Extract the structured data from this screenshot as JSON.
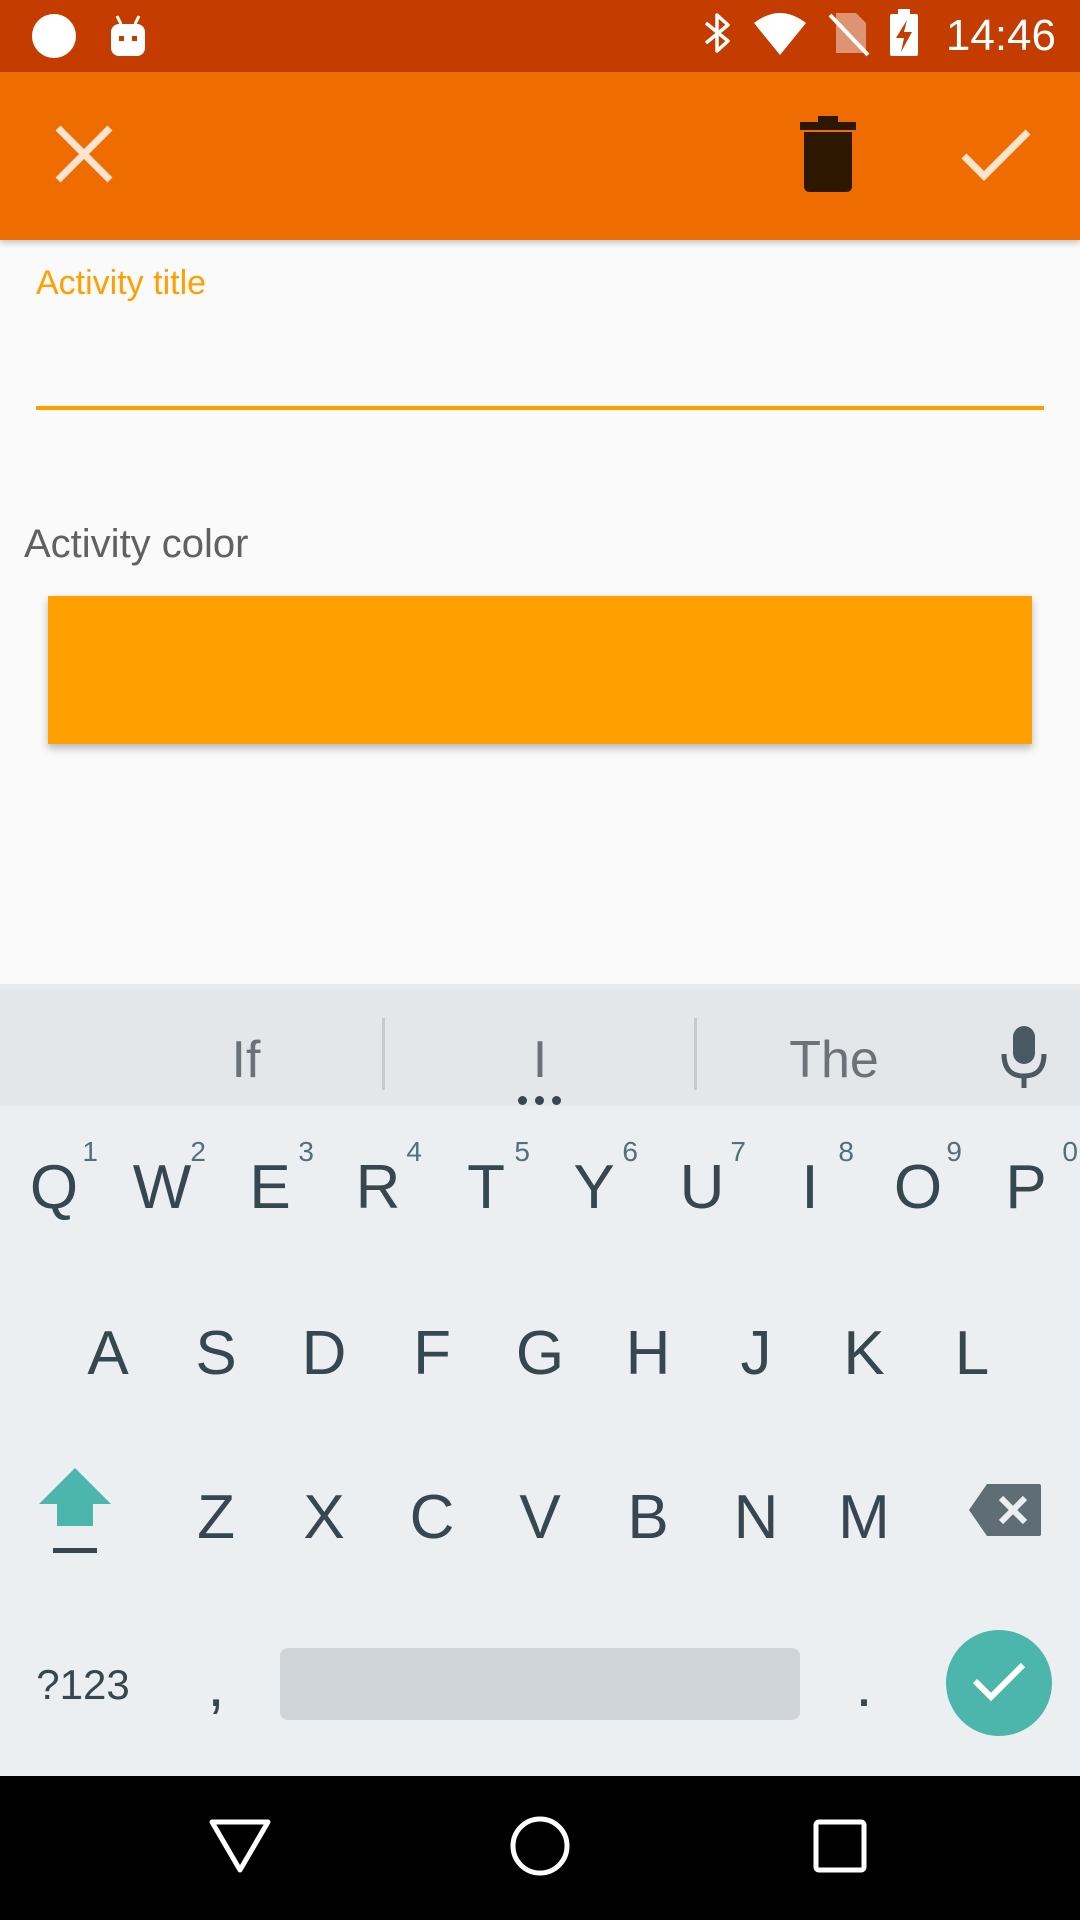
{
  "status_bar": {
    "time": "14:46",
    "left_icons": [
      "circle-notification-icon",
      "android-notification-icon"
    ],
    "right_icons": [
      "bluetooth-icon",
      "wifi-icon",
      "no-sim-icon",
      "battery-charging-icon"
    ]
  },
  "app_bar": {
    "close_icon": "close-icon",
    "delete_icon": "delete-icon",
    "confirm_icon": "check-icon"
  },
  "form": {
    "title_label": "Activity title",
    "title_value": "",
    "color_label": "Activity color",
    "selected_color": "#ffa000"
  },
  "keyboard": {
    "suggestions": [
      "If",
      "I",
      "The"
    ],
    "row1": [
      {
        "key": "Q",
        "num": "1"
      },
      {
        "key": "W",
        "num": "2"
      },
      {
        "key": "E",
        "num": "3"
      },
      {
        "key": "R",
        "num": "4"
      },
      {
        "key": "T",
        "num": "5"
      },
      {
        "key": "Y",
        "num": "6"
      },
      {
        "key": "U",
        "num": "7"
      },
      {
        "key": "I",
        "num": "8"
      },
      {
        "key": "O",
        "num": "9"
      },
      {
        "key": "P",
        "num": "0"
      }
    ],
    "row2": [
      "A",
      "S",
      "D",
      "F",
      "G",
      "H",
      "J",
      "K",
      "L"
    ],
    "row3": [
      "Z",
      "X",
      "C",
      "V",
      "B",
      "N",
      "M"
    ],
    "symbols_label": "?123",
    "comma": ",",
    "period": "."
  },
  "colors": {
    "status_bar": "#c43c00",
    "app_bar": "#ef6c00",
    "accent": "#ffa000",
    "enter_key": "#4db6ac"
  }
}
